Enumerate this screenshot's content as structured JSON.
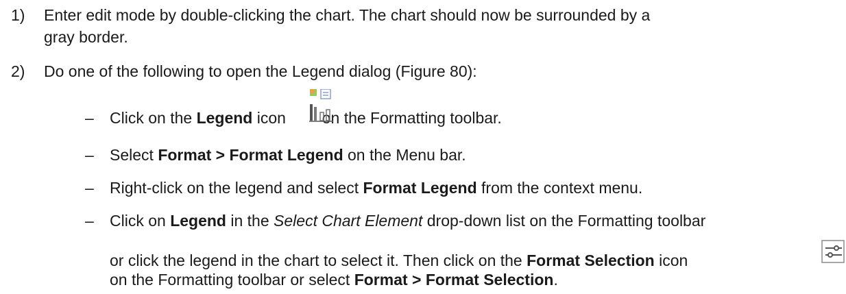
{
  "steps": [
    {
      "number": "1)",
      "line1": "Enter edit mode by double-clicking the chart. The chart should now be surrounded by a",
      "line2": "gray border."
    },
    {
      "number": "2)",
      "text": "Do one of the following to open the Legend dialog (Figure 80):"
    }
  ],
  "bullets": {
    "dash": "–",
    "b1": {
      "a": "Click on the ",
      "b": "Legend",
      "c": " icon ",
      "d": " on the Formatting toolbar."
    },
    "b2": {
      "a": "Select ",
      "b": "Format > Format Legend",
      "c": " on the Menu bar."
    },
    "b3": {
      "a": "Right-click on the legend and select ",
      "b": "Format Legend",
      "c": " from the context menu."
    },
    "b4": {
      "a": "Click on ",
      "b": "Legend",
      "c": " in the ",
      "d": "Select Chart Element",
      "e": " drop-down list on the Formatting toolbar",
      "f": "or click the legend in the chart to select it. Then click on the ",
      "g": "Format Selection",
      "h": " icon",
      "i": "on the Formatting toolbar or select ",
      "j": "Format > Format Selection",
      "k": "."
    }
  },
  "icons": [
    "legend-icon",
    "format-selection-icon"
  ]
}
